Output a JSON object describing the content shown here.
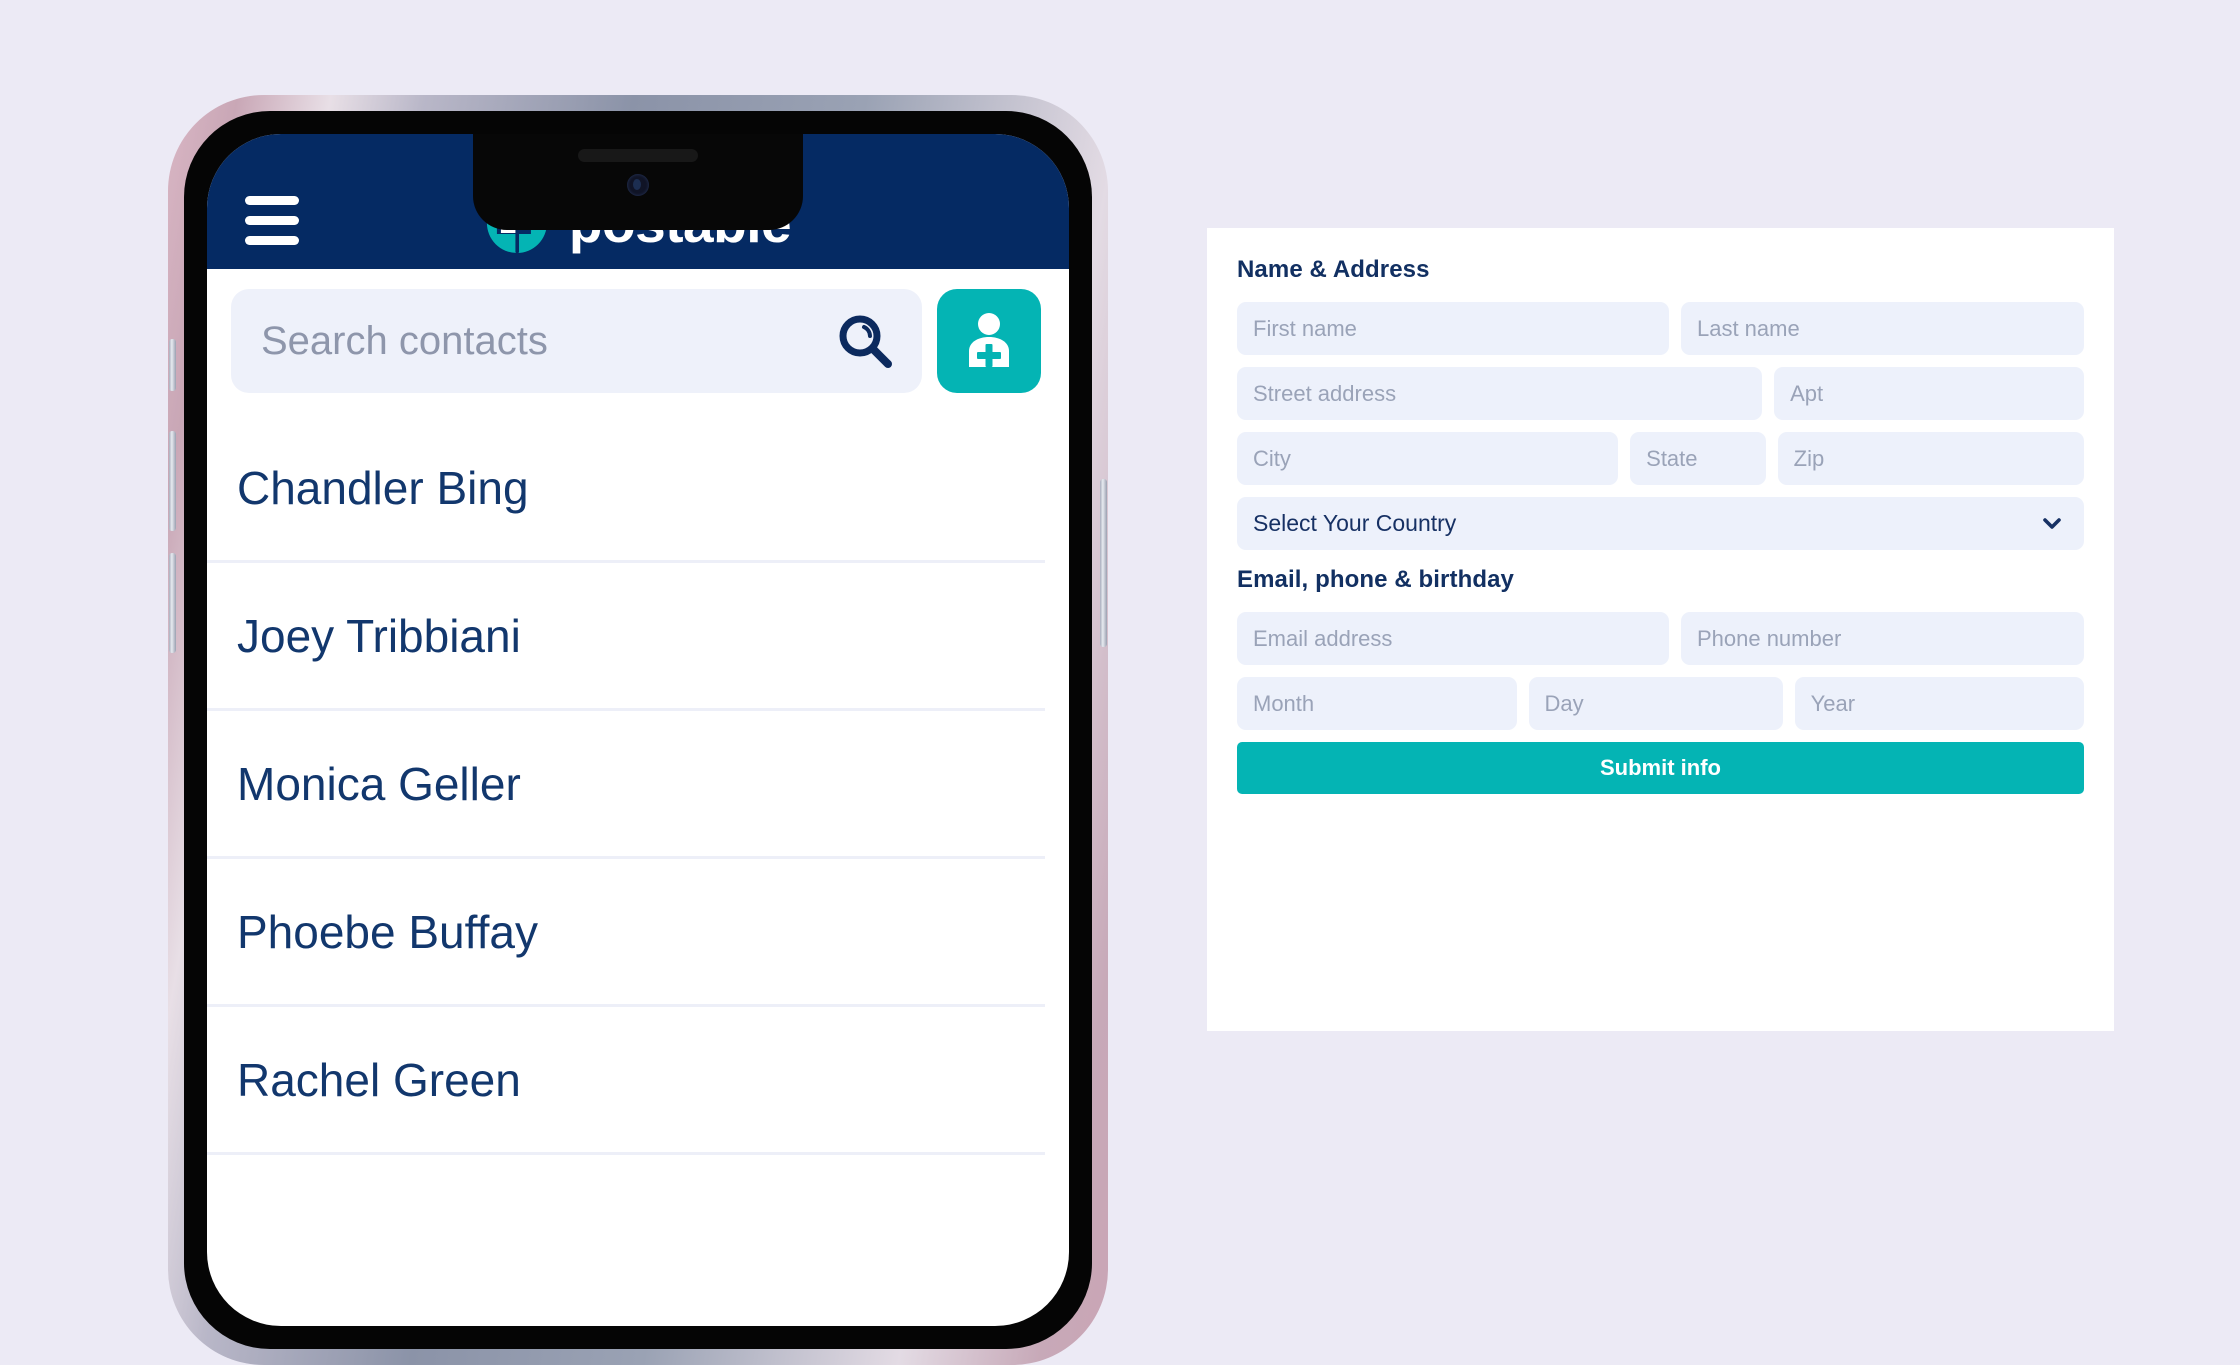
{
  "theme": {
    "page_background": "#eceaf5",
    "brand_navy": "#052a63",
    "brand_teal": "#04b4b4",
    "field_background": "#edf1fb",
    "placeholder_text": "#9aa3b8",
    "logo_flag": "#9e6478"
  },
  "phone_app": {
    "header": {
      "menu_icon": "hamburger-menu-icon",
      "logo_icon": "mailbox-logo-icon",
      "brand_name": "postable"
    },
    "search": {
      "placeholder": "Search contacts",
      "value": "",
      "search_icon": "magnifying-glass-icon",
      "add_contact_icon": "person-plus-icon"
    },
    "contacts": [
      {
        "name": "Chandler Bing"
      },
      {
        "name": "Joey Tribbiani"
      },
      {
        "name": "Monica Geller"
      },
      {
        "name": "Phoebe Buffay"
      },
      {
        "name": "Rachel Green"
      }
    ]
  },
  "form": {
    "sections": {
      "name_address_title": "Name & Address",
      "email_phone_title": "Email, phone & birthday"
    },
    "fields": {
      "first_name": {
        "placeholder": "First name",
        "value": ""
      },
      "last_name": {
        "placeholder": "Last name",
        "value": ""
      },
      "street_address": {
        "placeholder": "Street address",
        "value": ""
      },
      "apt": {
        "placeholder": "Apt",
        "value": ""
      },
      "city": {
        "placeholder": "City",
        "value": ""
      },
      "state": {
        "placeholder": "State",
        "value": ""
      },
      "zip": {
        "placeholder": "Zip",
        "value": ""
      },
      "country": {
        "selected": "Select Your Country",
        "chevron_icon": "chevron-down-icon"
      },
      "email": {
        "placeholder": "Email address",
        "value": ""
      },
      "phone": {
        "placeholder": "Phone number",
        "value": ""
      },
      "month": {
        "placeholder": "Month",
        "value": ""
      },
      "day": {
        "placeholder": "Day",
        "value": ""
      },
      "year": {
        "placeholder": "Year",
        "value": ""
      }
    },
    "submit_label": "Submit info"
  }
}
